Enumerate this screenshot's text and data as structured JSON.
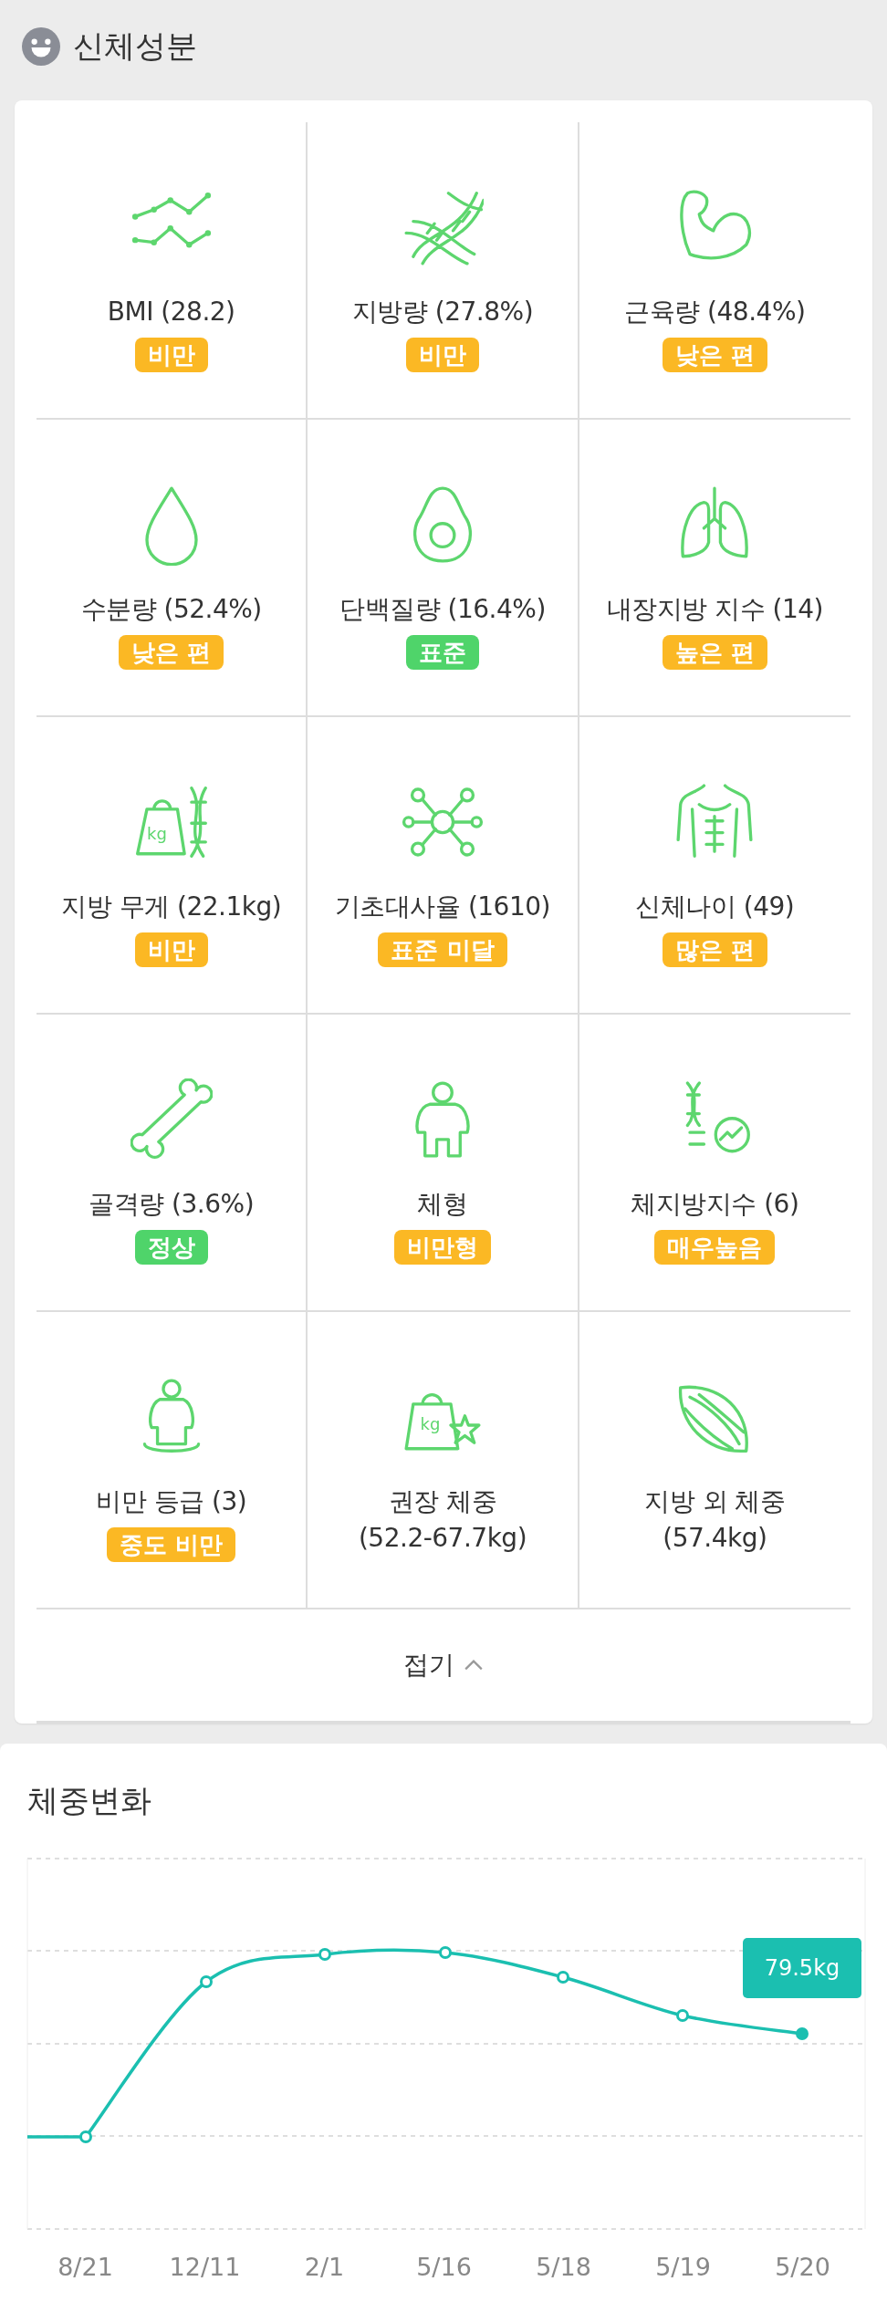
{
  "section_title": "신체성분",
  "metric_rows": [
    {
      "metrics": [
        {
          "kind": "badge",
          "label": "BMI (28.2)",
          "badge": "비만",
          "color": "#fbb824"
        },
        {
          "kind": "badge",
          "label": "지방량 (27.8%)",
          "badge": "비만",
          "color": "#fbb824"
        },
        {
          "kind": "badge",
          "label": "근육량 (48.4%)",
          "badge": "낮은 편",
          "color": "#fbb824"
        }
      ]
    },
    {
      "metrics": [
        {
          "kind": "badge",
          "label": "수분량 (52.4%)",
          "badge": "낮은 편",
          "color": "#fbb824"
        },
        {
          "kind": "badge",
          "label": "단백질량 (16.4%)",
          "badge": "표준",
          "color": "#4fd46a"
        },
        {
          "kind": "badge",
          "label": "내장지방 지수 (14)",
          "badge": "높은 편",
          "color": "#fbb824"
        }
      ]
    },
    {
      "metrics": [
        {
          "kind": "badge",
          "label": "지방 무게 (22.1kg)",
          "badge": "비만",
          "color": "#fbb824",
          "icon_text": "kg"
        },
        {
          "kind": "badge",
          "label": "기초대사율 (1610)",
          "badge": "표준 미달",
          "color": "#fbb824"
        },
        {
          "kind": "badge",
          "label": "신체나이 (49)",
          "badge": "많은 편",
          "color": "#fbb824"
        }
      ]
    },
    {
      "metrics": [
        {
          "kind": "badge",
          "label": "골격량 (3.6%)",
          "badge": "정상",
          "color": "#4fd46a"
        },
        {
          "kind": "badge",
          "label": "체형",
          "badge": "비만형",
          "color": "#fbb824"
        },
        {
          "kind": "badge",
          "label": "체지방지수 (6)",
          "badge": "매우높음",
          "color": "#fbb824"
        }
      ]
    },
    {
      "metrics": [
        {
          "kind": "badge",
          "label": "비만 등급 (3)",
          "badge": "중도 비만",
          "color": "#fbb824"
        },
        {
          "kind": "range",
          "label": "권장 체중",
          "value": "(52.2-67.7kg)",
          "icon_text": "kg"
        },
        {
          "kind": "range",
          "label": "지방 외 체중",
          "value": "(57.4kg)"
        }
      ]
    }
  ],
  "collapse_label": "접기",
  "weight_chart": {
    "title": "체중변화",
    "x_labels": [
      "8/21",
      "12/11",
      "2/1",
      "5/16",
      "5/18",
      "5/19",
      "5/20"
    ],
    "tooltip": "79.5kg"
  }
}
